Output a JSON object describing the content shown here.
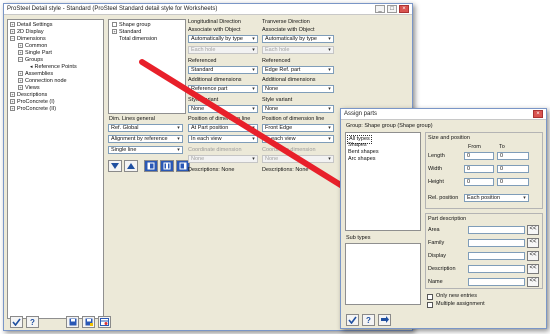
{
  "main": {
    "title": "ProSteel Detail style - Standard (ProSteel Standard detail style for Worksheets)",
    "tree": [
      "Detail Settings",
      "2D Display",
      "Dimensions",
      "Common",
      "Single Part",
      "Groups",
      "Reference Points",
      "Assemblies",
      "Connection node",
      "Views",
      "Descriptions",
      "ProConcrete (I)",
      "ProConcrete (II)"
    ],
    "shape_list": [
      "Shape group",
      "Standard",
      "Total dimension"
    ],
    "dim_lines_general": "Dim. Lines general",
    "ref_global": "Ref. Global",
    "alignment": "Alignment by reference",
    "single_line": "Single line",
    "long": {
      "header": "Longitudinal Direction",
      "assoc_label": "Associate with Object",
      "assoc_value": "Automatically by type",
      "each_hole": "Each hole",
      "referenced_label": "Referenced",
      "referenced_value": "Standard",
      "additional_label": "Additional dimensions",
      "additional_value": "Reference part",
      "style_label": "Style variant",
      "style_value": "None",
      "position_label": "Position of dimension line",
      "position_value": "At Part position",
      "view_value": "In each view",
      "coord_label": "Coordinate dimension",
      "coord_value": "None",
      "desc": "Descriptions: None"
    },
    "trans": {
      "header": "Tranverse Direction",
      "assoc_label": "Associate with Object",
      "assoc_value": "Automatically by type",
      "each_hole": "Each hole",
      "referenced_label": "Referenced",
      "referenced_value": "Edge Ref. part",
      "additional_label": "Additional dimensions",
      "additional_value": "None",
      "style_label": "Style variant",
      "style_value": "None",
      "position_label": "Position of dimension line",
      "position_value": "Front Edge",
      "view_value": "In each view",
      "coord_label": "Coordinate dimension",
      "coord_value": "None",
      "desc": "Descriptions: None"
    }
  },
  "assign": {
    "title": "Assign parts",
    "group_label": "Group: Shape group (Shape group)",
    "list": [
      "All types",
      "Shapes",
      "Bent shapes",
      "Arc shapes"
    ],
    "sub_types": "Sub types",
    "size_header": "Size and position",
    "from": "From",
    "to": "To",
    "rows": [
      {
        "label": "Length",
        "from": "0",
        "to": "0"
      },
      {
        "label": "Width",
        "from": "0",
        "to": "0"
      },
      {
        "label": "Height",
        "from": "0",
        "to": "0"
      }
    ],
    "rel_position_label": "Rel. position",
    "rel_position_value": "Each position",
    "part_desc_header": "Part description",
    "desc_fields": [
      "Area",
      "Family",
      "Display",
      "Description",
      "Name"
    ],
    "only_new": "Only new entries",
    "multiple": "Multiple assignment",
    "lt_label": "<<"
  },
  "colors": {
    "arrow": "#e8202a",
    "highlight": "#316ac5"
  }
}
